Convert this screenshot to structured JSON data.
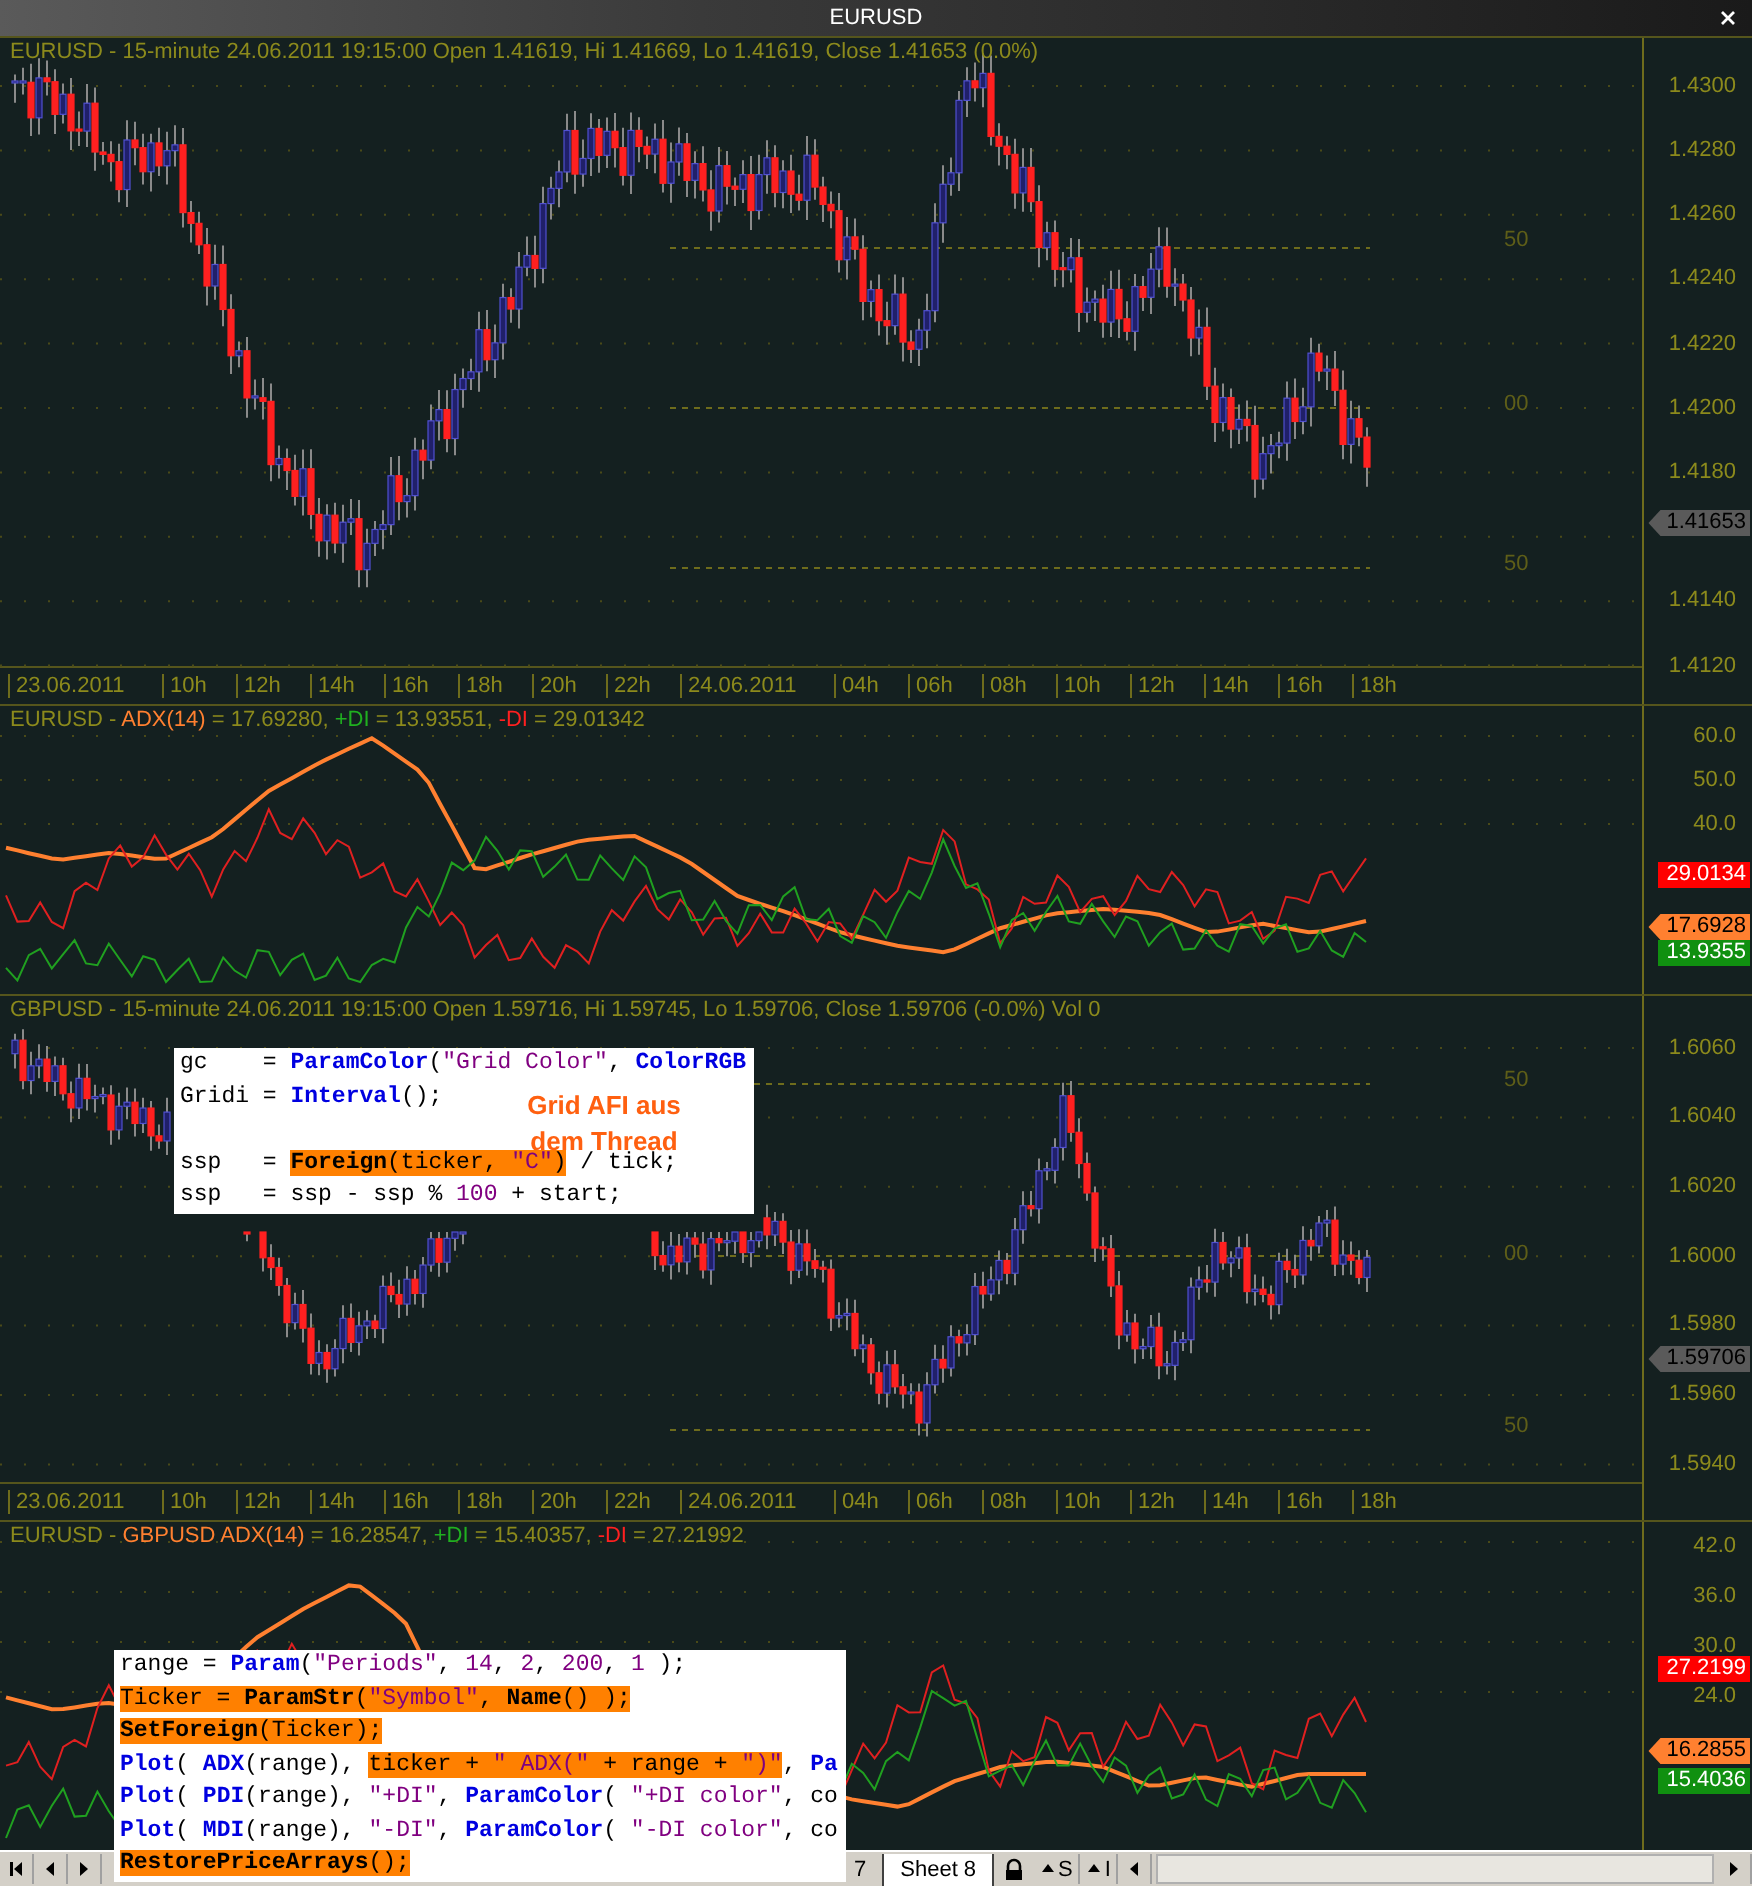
{
  "window": {
    "title": "EURUSD"
  },
  "panels": [
    {
      "kind": "price",
      "header": [
        {
          "text": "EURUSD - 15-minute 24.06.2011 19:15:00 Open 1.41619, Hi 1.41669, Lo 1.41619, Close 1.41653 (0.0%)",
          "color": "#8c8a1c"
        }
      ],
      "axis_ticks": [
        "1.4300",
        "1.4280",
        "1.4260",
        "1.4240",
        "1.4220",
        "1.4200",
        "1.4180",
        "1.4140",
        "1.4120"
      ],
      "tags": [
        {
          "text": "1.41653",
          "color": "#5a5a5a",
          "kind": "pointer"
        }
      ],
      "grid_labels": [
        "50",
        "00",
        "50"
      ],
      "time_labels": [
        {
          "text": "23.06.2011",
          "kind": "date"
        },
        {
          "text": "10h",
          "kind": "hour"
        },
        {
          "text": "12h",
          "kind": "hour"
        },
        {
          "text": "14h",
          "kind": "hour"
        },
        {
          "text": "16h",
          "kind": "hour"
        },
        {
          "text": "18h",
          "kind": "hour"
        },
        {
          "text": "20h",
          "kind": "hour"
        },
        {
          "text": "22h",
          "kind": "hour"
        },
        {
          "text": "24.06.2011",
          "kind": "date"
        },
        {
          "text": "04h",
          "kind": "hour"
        },
        {
          "text": "06h",
          "kind": "hour"
        },
        {
          "text": "08h",
          "kind": "hour"
        },
        {
          "text": "10h",
          "kind": "hour"
        },
        {
          "text": "12h",
          "kind": "hour"
        },
        {
          "text": "14h",
          "kind": "hour"
        },
        {
          "text": "16h",
          "kind": "hour"
        },
        {
          "text": "18h",
          "kind": "hour"
        }
      ]
    },
    {
      "kind": "indicator",
      "header": [
        {
          "text": "EURUSD - ",
          "color": "#8c8a1c"
        },
        {
          "text": "ADX(14)",
          "color": "#ff8030"
        },
        {
          "text": " = 17.69280, ",
          "color": "#8c8a1c"
        },
        {
          "text": "+DI",
          "color": "#20b020"
        },
        {
          "text": " = 13.93551, ",
          "color": "#8c8a1c"
        },
        {
          "text": "-DI",
          "color": "#ff2020"
        },
        {
          "text": " = 29.01342",
          "color": "#8c8a1c"
        }
      ],
      "axis_ticks": [
        "60.0",
        "50.0",
        "40.0"
      ],
      "tags": [
        {
          "text": "29.0134",
          "color": "#ff0000",
          "kind": "plain"
        },
        {
          "text": "17.6928",
          "color": "#ff8030",
          "kind": "pointer"
        },
        {
          "text": "13.9355",
          "color": "#109010",
          "kind": "plain"
        }
      ]
    },
    {
      "kind": "price",
      "header": [
        {
          "text": "GBPUSD - 15-minute 24.06.2011 19:15:00 Open 1.59716, Hi 1.59745, Lo 1.59706, Close 1.59706 (-0.0%) Vol 0",
          "color": "#8c8a1c"
        }
      ],
      "axis_ticks": [
        "1.6060",
        "1.6040",
        "1.6020",
        "1.6000",
        "1.5980",
        "1.5960",
        "1.5940"
      ],
      "tags": [
        {
          "text": "1.59706",
          "color": "#5a5a5a",
          "kind": "pointer"
        }
      ],
      "grid_labels": [
        "50",
        "00",
        "50"
      ],
      "time_labels": [
        {
          "text": "23.06.2011",
          "kind": "date"
        },
        {
          "text": "10h",
          "kind": "hour"
        },
        {
          "text": "12h",
          "kind": "hour"
        },
        {
          "text": "14h",
          "kind": "hour"
        },
        {
          "text": "16h",
          "kind": "hour"
        },
        {
          "text": "18h",
          "kind": "hour"
        },
        {
          "text": "20h",
          "kind": "hour"
        },
        {
          "text": "22h",
          "kind": "hour"
        },
        {
          "text": "24.06.2011",
          "kind": "date"
        },
        {
          "text": "04h",
          "kind": "hour"
        },
        {
          "text": "06h",
          "kind": "hour"
        },
        {
          "text": "08h",
          "kind": "hour"
        },
        {
          "text": "10h",
          "kind": "hour"
        },
        {
          "text": "12h",
          "kind": "hour"
        },
        {
          "text": "14h",
          "kind": "hour"
        },
        {
          "text": "16h",
          "kind": "hour"
        },
        {
          "text": "18h",
          "kind": "hour"
        }
      ]
    },
    {
      "kind": "indicator",
      "header": [
        {
          "text": "EURUSD - ",
          "color": "#8c8a1c"
        },
        {
          "text": "GBPUSD ADX(14)",
          "color": "#ff8030"
        },
        {
          "text": " = 16.28547, ",
          "color": "#8c8a1c"
        },
        {
          "text": "+DI",
          "color": "#20b020"
        },
        {
          "text": " = 15.40357, ",
          "color": "#8c8a1c"
        },
        {
          "text": "-DI",
          "color": "#ff2020"
        },
        {
          "text": " = 27.21992",
          "color": "#8c8a1c"
        }
      ],
      "axis_ticks": [
        "42.0",
        "36.0",
        "30.0",
        "24.0"
      ],
      "tags": [
        {
          "text": "27.2199",
          "color": "#ff0000",
          "kind": "plain"
        },
        {
          "text": "16.2855",
          "color": "#ff8030",
          "kind": "pointer"
        },
        {
          "text": "15.4036",
          "color": "#109010",
          "kind": "plain"
        }
      ]
    }
  ],
  "code_boxes": [
    {
      "note": "Grid AFI aus dem Thread",
      "lines": [
        [
          {
            "text": "gc    = ",
            "kind": "plain",
            "highlighted": false
          },
          {
            "text": "ParamColor",
            "kind": "func",
            "highlighted": false
          },
          {
            "text": "(",
            "kind": "plain",
            "highlighted": false
          },
          {
            "text": "\"Grid Color\"",
            "kind": "literal",
            "highlighted": false
          },
          {
            "text": ", ",
            "kind": "plain",
            "highlighted": false
          },
          {
            "text": "ColorRGB",
            "kind": "func",
            "highlighted": false
          }
        ],
        [
          {
            "text": "Gridi = ",
            "kind": "plain",
            "highlighted": false
          },
          {
            "text": "Interval",
            "kind": "func",
            "highlighted": false
          },
          {
            "text": "();",
            "kind": "plain",
            "highlighted": false
          }
        ],
        [
          {
            "text": "ssp   = ",
            "kind": "plain",
            "highlighted": false
          },
          {
            "text": "Foreign",
            "kind": "func",
            "highlighted": true
          },
          {
            "text": "(ticker, ",
            "kind": "plain",
            "highlighted": true
          },
          {
            "text": "\"C\"",
            "kind": "literal",
            "highlighted": true
          },
          {
            "text": ")",
            "kind": "plain",
            "highlighted": true
          },
          {
            "text": " / tick;",
            "kind": "plain",
            "highlighted": false
          }
        ],
        [
          {
            "text": "ssp   = ssp - ssp % ",
            "kind": "plain",
            "highlighted": false
          },
          {
            "text": "100",
            "kind": "literal",
            "highlighted": false
          },
          {
            "text": " + start;",
            "kind": "plain",
            "highlighted": false
          }
        ]
      ]
    },
    {
      "lines": [
        [
          {
            "text": "range = ",
            "kind": "plain",
            "highlighted": false
          },
          {
            "text": "Param",
            "kind": "func",
            "highlighted": false
          },
          {
            "text": "(",
            "kind": "plain",
            "highlighted": false
          },
          {
            "text": "\"Periods\"",
            "kind": "literal",
            "highlighted": false
          },
          {
            "text": ", ",
            "kind": "plain",
            "highlighted": false
          },
          {
            "text": "14",
            "kind": "literal",
            "highlighted": false
          },
          {
            "text": ", ",
            "kind": "plain",
            "highlighted": false
          },
          {
            "text": "2",
            "kind": "literal",
            "highlighted": false
          },
          {
            "text": ", ",
            "kind": "plain",
            "highlighted": false
          },
          {
            "text": "200",
            "kind": "literal",
            "highlighted": false
          },
          {
            "text": ", ",
            "kind": "plain",
            "highlighted": false
          },
          {
            "text": "1",
            "kind": "literal",
            "highlighted": false
          },
          {
            "text": " );",
            "kind": "plain",
            "highlighted": false
          }
        ],
        [
          {
            "text": "Ticker = ",
            "kind": "plain",
            "highlighted": true
          },
          {
            "text": "ParamStr",
            "kind": "func",
            "highlighted": true
          },
          {
            "text": "(",
            "kind": "plain",
            "highlighted": true
          },
          {
            "text": "\"Symbol\"",
            "kind": "literal",
            "highlighted": true
          },
          {
            "text": ", ",
            "kind": "plain",
            "highlighted": true
          },
          {
            "text": "Name",
            "kind": "func",
            "highlighted": true
          },
          {
            "text": "() );",
            "kind": "plain",
            "highlighted": true
          }
        ],
        [
          {
            "text": "SetForeign",
            "kind": "func",
            "highlighted": true
          },
          {
            "text": "(Ticker);",
            "kind": "plain",
            "highlighted": true
          }
        ],
        [
          {
            "text": "Plot",
            "kind": "func",
            "highlighted": false
          },
          {
            "text": "( ",
            "kind": "plain",
            "highlighted": false
          },
          {
            "text": "ADX",
            "kind": "func",
            "highlighted": false
          },
          {
            "text": "(range), ",
            "kind": "plain",
            "highlighted": false
          },
          {
            "text": "ticker + ",
            "kind": "plain",
            "highlighted": true
          },
          {
            "text": "\" ADX(\"",
            "kind": "literal",
            "highlighted": true
          },
          {
            "text": " + range + ",
            "kind": "plain",
            "highlighted": true
          },
          {
            "text": "\")\"",
            "kind": "literal",
            "highlighted": true
          },
          {
            "text": ", ",
            "kind": "plain",
            "highlighted": false
          },
          {
            "text": "Pa",
            "kind": "func",
            "highlighted": false
          }
        ],
        [
          {
            "text": "Plot",
            "kind": "func",
            "highlighted": false
          },
          {
            "text": "( ",
            "kind": "plain",
            "highlighted": false
          },
          {
            "text": "PDI",
            "kind": "func",
            "highlighted": false
          },
          {
            "text": "(range), ",
            "kind": "plain",
            "highlighted": false
          },
          {
            "text": "\"+DI\"",
            "kind": "literal",
            "highlighted": false
          },
          {
            "text": ", ",
            "kind": "plain",
            "highlighted": false
          },
          {
            "text": "ParamColor",
            "kind": "func",
            "highlighted": false
          },
          {
            "text": "( ",
            "kind": "plain",
            "highlighted": false
          },
          {
            "text": "\"+DI color\"",
            "kind": "literal",
            "highlighted": false
          },
          {
            "text": ", co",
            "kind": "plain",
            "highlighted": false
          }
        ],
        [
          {
            "text": "Plot",
            "kind": "func",
            "highlighted": false
          },
          {
            "text": "( ",
            "kind": "plain",
            "highlighted": false
          },
          {
            "text": "MDI",
            "kind": "func",
            "highlighted": false
          },
          {
            "text": "(range), ",
            "kind": "plain",
            "highlighted": false
          },
          {
            "text": "\"-DI\"",
            "kind": "literal",
            "highlighted": false
          },
          {
            "text": ", ",
            "kind": "plain",
            "highlighted": false
          },
          {
            "text": "ParamColor",
            "kind": "func",
            "highlighted": false
          },
          {
            "text": "( ",
            "kind": "plain",
            "highlighted": false
          },
          {
            "text": "\"-DI color\"",
            "kind": "literal",
            "highlighted": false
          },
          {
            "text": ", co",
            "kind": "plain",
            "highlighted": false
          }
        ],
        [
          {
            "text": "RestorePriceArrays",
            "kind": "func",
            "highlighted": true
          },
          {
            "text": "();",
            "kind": "plain",
            "highlighted": true
          }
        ]
      ]
    }
  ],
  "sheet_bar": {
    "tabs": [
      {
        "label": "7",
        "selected": false
      },
      {
        "label": "Sheet 8",
        "selected": true
      }
    ],
    "buttons": [
      "S",
      "I"
    ]
  }
}
